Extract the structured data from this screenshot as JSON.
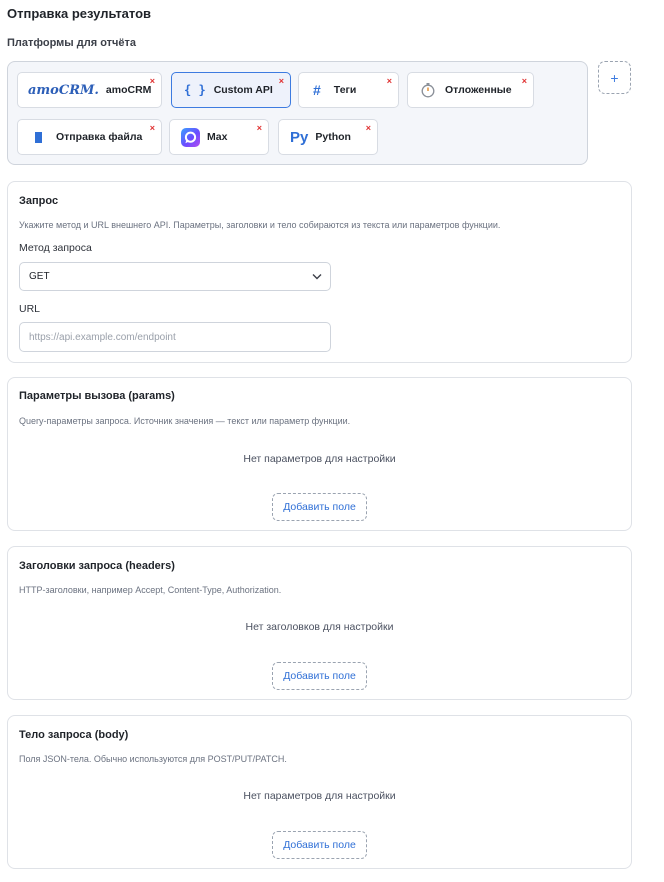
{
  "page": {
    "title": "Отправка результатов"
  },
  "platforms": {
    "label": "Платформы для отчёта",
    "items": [
      {
        "id": "amocrm",
        "label": "amoCRM",
        "logo_text": "amoCRM.",
        "icon": "amocrm-logo",
        "active": false
      },
      {
        "id": "custom-api",
        "label": "Custom API",
        "icon_text": "{ }",
        "icon": "braces-icon",
        "active": true
      },
      {
        "id": "tags",
        "label": "Теги",
        "icon_text": "#",
        "icon": "hash-icon",
        "active": false
      },
      {
        "id": "delayed",
        "label": "Отложенные",
        "icon": "stopwatch-icon",
        "active": false
      },
      {
        "id": "file",
        "label": "Отправка файла",
        "icon": "file-icon",
        "active": false
      },
      {
        "id": "max",
        "label": "Max",
        "icon": "max-logo",
        "active": false
      },
      {
        "id": "python",
        "label": "Python",
        "icon_text": "Py",
        "icon": "python-icon",
        "active": false
      }
    ],
    "remove_glyph": "×",
    "add_glyph": "+"
  },
  "colors": {
    "accent": "#3d7be0",
    "remove": "#e03131",
    "border": "#dfe2e7"
  },
  "request": {
    "title": "Запрос",
    "description": "Укажите метод и URL внешнего API. Параметры, заголовки и тело собираются из текста или параметров функции.",
    "method_label": "Метод запроса",
    "method_value": "GET",
    "url_label": "URL",
    "url_value": "",
    "url_placeholder": "https://api.example.com/endpoint"
  },
  "params": {
    "title": "Параметры вызова (params)",
    "description": "Query-параметры запроса. Источник значения — текст или параметр функции.",
    "empty": "Нет параметров для настройки",
    "add_label": "Добавить поле"
  },
  "headers": {
    "title": "Заголовки запроса (headers)",
    "description": "HTTP-заголовки, например Accept, Content-Type, Authorization.",
    "empty": "Нет заголовков для настройки",
    "add_label": "Добавить поле"
  },
  "body": {
    "title": "Тело запроса (body)",
    "description": "Поля JSON-тела. Обычно используются для POST/PUT/PATCH.",
    "empty": "Нет параметров для настройки",
    "add_label": "Добавить поле"
  }
}
